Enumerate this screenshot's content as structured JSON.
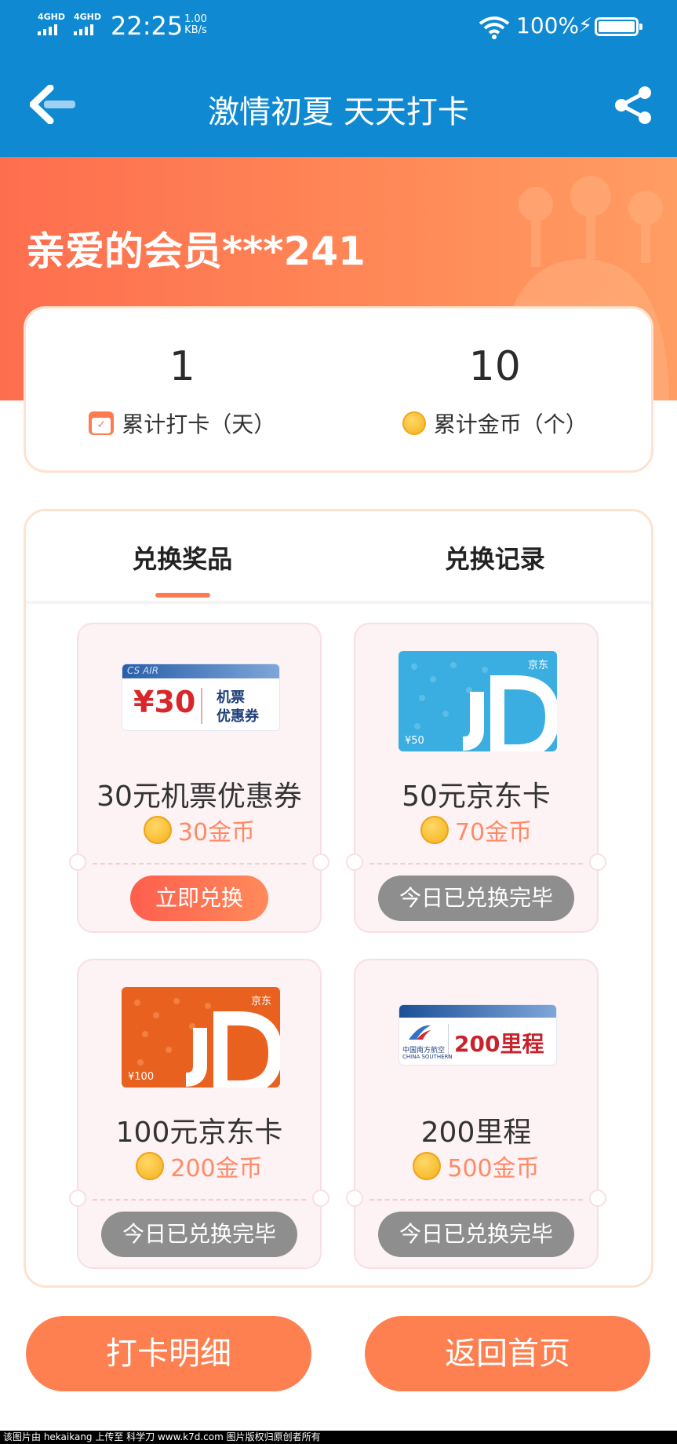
{
  "status_bar": {
    "signal1": "4GHD",
    "signal2": "4GHD",
    "time": "22:25",
    "speed_value": "1.00",
    "speed_unit": "KB/s",
    "battery": "100%"
  },
  "header": {
    "title": "激情初夏 天天打卡",
    "back_icon": "back-arrow-icon",
    "share_icon": "share-icon"
  },
  "greeting": "亲爱的会员***241",
  "stats": {
    "checkin_days": "1",
    "checkin_label": "累计打卡（天）",
    "coins": "10",
    "coins_label": "累计金币（个）"
  },
  "tabs": {
    "redeem": "兑换奖品",
    "records": "兑换记录"
  },
  "rewards": [
    {
      "name": "30元机票优惠券",
      "price": "30金币",
      "button": "立即兑换",
      "status": "active",
      "thumb": {
        "type": "air",
        "amount": "¥30",
        "line1": "机票",
        "line2": "优惠券",
        "banner": "CS AIR"
      }
    },
    {
      "name": "50元京东卡",
      "price": "70金币",
      "button": "今日已兑换完毕",
      "status": "done",
      "thumb": {
        "type": "jd",
        "value": "¥50",
        "color": "#3aaee0"
      }
    },
    {
      "name": "100元京东卡",
      "price": "200金币",
      "button": "今日已兑换完毕",
      "status": "done",
      "thumb": {
        "type": "jd",
        "value": "¥100",
        "color": "#e9611f"
      }
    },
    {
      "name": "200里程",
      "price": "500金币",
      "button": "今日已兑换完毕",
      "status": "done",
      "thumb": {
        "type": "miles",
        "text": "200里程",
        "airline": "中国南方航空",
        "airline_en": "CHINA SOUTHERN"
      }
    }
  ],
  "bottom": {
    "detail": "打卡明细",
    "home": "返回首页"
  },
  "watermark": "该图片由 hekaikang 上传至 科学刀 www.k7d.com 图片版权归原创者所有",
  "colors": {
    "header_bg": "#0f89d2",
    "accent": "#fe7f4f",
    "coin_text": "#ff8a67",
    "disabled": "#8e8e8e"
  }
}
